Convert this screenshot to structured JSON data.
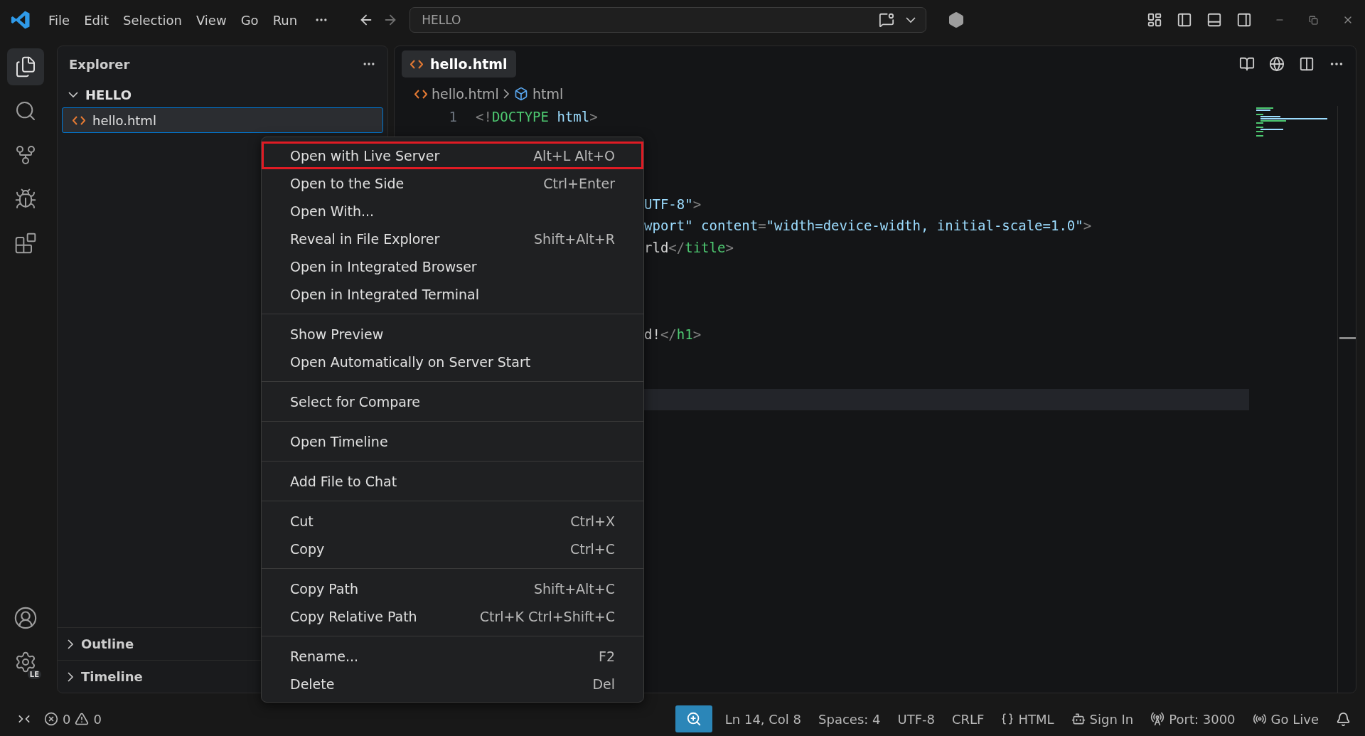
{
  "title_bar": {
    "menus": [
      "File",
      "Edit",
      "Selection",
      "View",
      "Go",
      "Run"
    ],
    "command_center": "HELLO"
  },
  "activity_bar": {
    "items": [
      {
        "kind": "files",
        "selected": true
      },
      {
        "kind": "search",
        "selected": false
      },
      {
        "kind": "source",
        "selected": false
      },
      {
        "kind": "debug",
        "selected": false
      },
      {
        "kind": "extensions",
        "selected": false
      }
    ],
    "profile_badge": "LE"
  },
  "sidebar": {
    "title": "Explorer",
    "folder": {
      "label": "HELLO",
      "expanded": true,
      "files": [
        {
          "name": "hello.html",
          "selected": true
        }
      ]
    },
    "sections": [
      {
        "label": "Outline",
        "expanded": false
      },
      {
        "label": "Timeline",
        "expanded": false
      }
    ]
  },
  "editor": {
    "tabs": [
      {
        "label": "hello.html",
        "selected": true
      }
    ],
    "breadcrumbs": [
      {
        "label": "hello.html",
        "kind": "file"
      },
      {
        "label": "html",
        "kind": "element"
      }
    ],
    "lines": [
      {
        "number": "1",
        "tokens": [
          {
            "kind": "punct",
            "t": "<!"
          },
          {
            "kind": "tag",
            "t": "DOCTYPE"
          },
          {
            "kind": "attr",
            "t": " html"
          },
          {
            "kind": "punct",
            "t": ">"
          }
        ]
      },
      {
        "covered": true,
        "tokens": [
          {
            "kind": "string",
            "t": "UTF-8\""
          },
          {
            "kind": "punct",
            "t": ">"
          }
        ]
      },
      {
        "covered": true,
        "tokens": [
          {
            "kind": "string",
            "t": "wport\""
          },
          {
            "kind": "attr",
            "t": " content"
          },
          {
            "kind": "punct",
            "t": "="
          },
          {
            "kind": "string",
            "t": "\"width=device-width, initial-scale=1.0\""
          },
          {
            "kind": "punct",
            "t": ">"
          }
        ]
      },
      {
        "covered": true,
        "tokens": [
          {
            "kind": "text",
            "t": "rld"
          },
          {
            "kind": "punct",
            "t": "</"
          },
          {
            "kind": "tag",
            "t": "title"
          },
          {
            "kind": "punct",
            "t": ">"
          }
        ]
      },
      {
        "covered": true,
        "tokens": [
          {
            "kind": "text",
            "t": "d!"
          },
          {
            "kind": "punct",
            "t": "</"
          },
          {
            "kind": "tag",
            "t": "h1"
          },
          {
            "kind": "punct",
            "t": ">"
          }
        ]
      },
      {
        "covered": true,
        "current": true
      }
    ]
  },
  "context_menu": {
    "groups": [
      [
        {
          "label": "Open with Live Server",
          "shortcut": "Alt+L Alt+O",
          "highlighted": true
        },
        {
          "label": "Open to the Side",
          "shortcut": "Ctrl+Enter",
          "highlighted": false
        },
        {
          "label": "Open With...",
          "highlighted": false
        },
        {
          "label": "Reveal in File Explorer",
          "shortcut": "Shift+Alt+R",
          "highlighted": false
        },
        {
          "label": "Open in Integrated Browser",
          "highlighted": false
        },
        {
          "label": "Open in Integrated Terminal",
          "highlighted": false
        }
      ],
      [
        {
          "label": "Show Preview",
          "highlighted": false
        },
        {
          "label": "Open Automatically on Server Start",
          "highlighted": false
        }
      ],
      [
        {
          "label": "Select for Compare",
          "highlighted": false
        }
      ],
      [
        {
          "label": "Open Timeline",
          "highlighted": false
        }
      ],
      [
        {
          "label": "Add File to Chat",
          "highlighted": false
        }
      ],
      [
        {
          "label": "Cut",
          "shortcut": "Ctrl+X",
          "highlighted": false
        },
        {
          "label": "Copy",
          "shortcut": "Ctrl+C",
          "highlighted": false
        }
      ],
      [
        {
          "label": "Copy Path",
          "shortcut": "Shift+Alt+C",
          "highlighted": false
        },
        {
          "label": "Copy Relative Path",
          "shortcut": "Ctrl+K Ctrl+Shift+C",
          "highlighted": false
        }
      ],
      [
        {
          "label": "Rename...",
          "shortcut": "F2",
          "highlighted": false
        },
        {
          "label": "Delete",
          "shortcut": "Del",
          "highlighted": false
        }
      ]
    ]
  },
  "status_bar": {
    "errors": "0",
    "warnings": "0",
    "items": [
      {
        "kind": "zoom"
      },
      {
        "kind": "text",
        "label": "Ln 14, Col 8"
      },
      {
        "kind": "text",
        "label": "Spaces: 4"
      },
      {
        "kind": "text",
        "label": "UTF-8"
      },
      {
        "kind": "text",
        "label": "CRLF"
      },
      {
        "kind": "language",
        "label": "HTML"
      },
      {
        "kind": "account",
        "label": "Sign In"
      },
      {
        "kind": "port",
        "label": "Port: 3000"
      },
      {
        "kind": "live",
        "label": "Go Live"
      },
      {
        "kind": "bell"
      }
    ]
  }
}
